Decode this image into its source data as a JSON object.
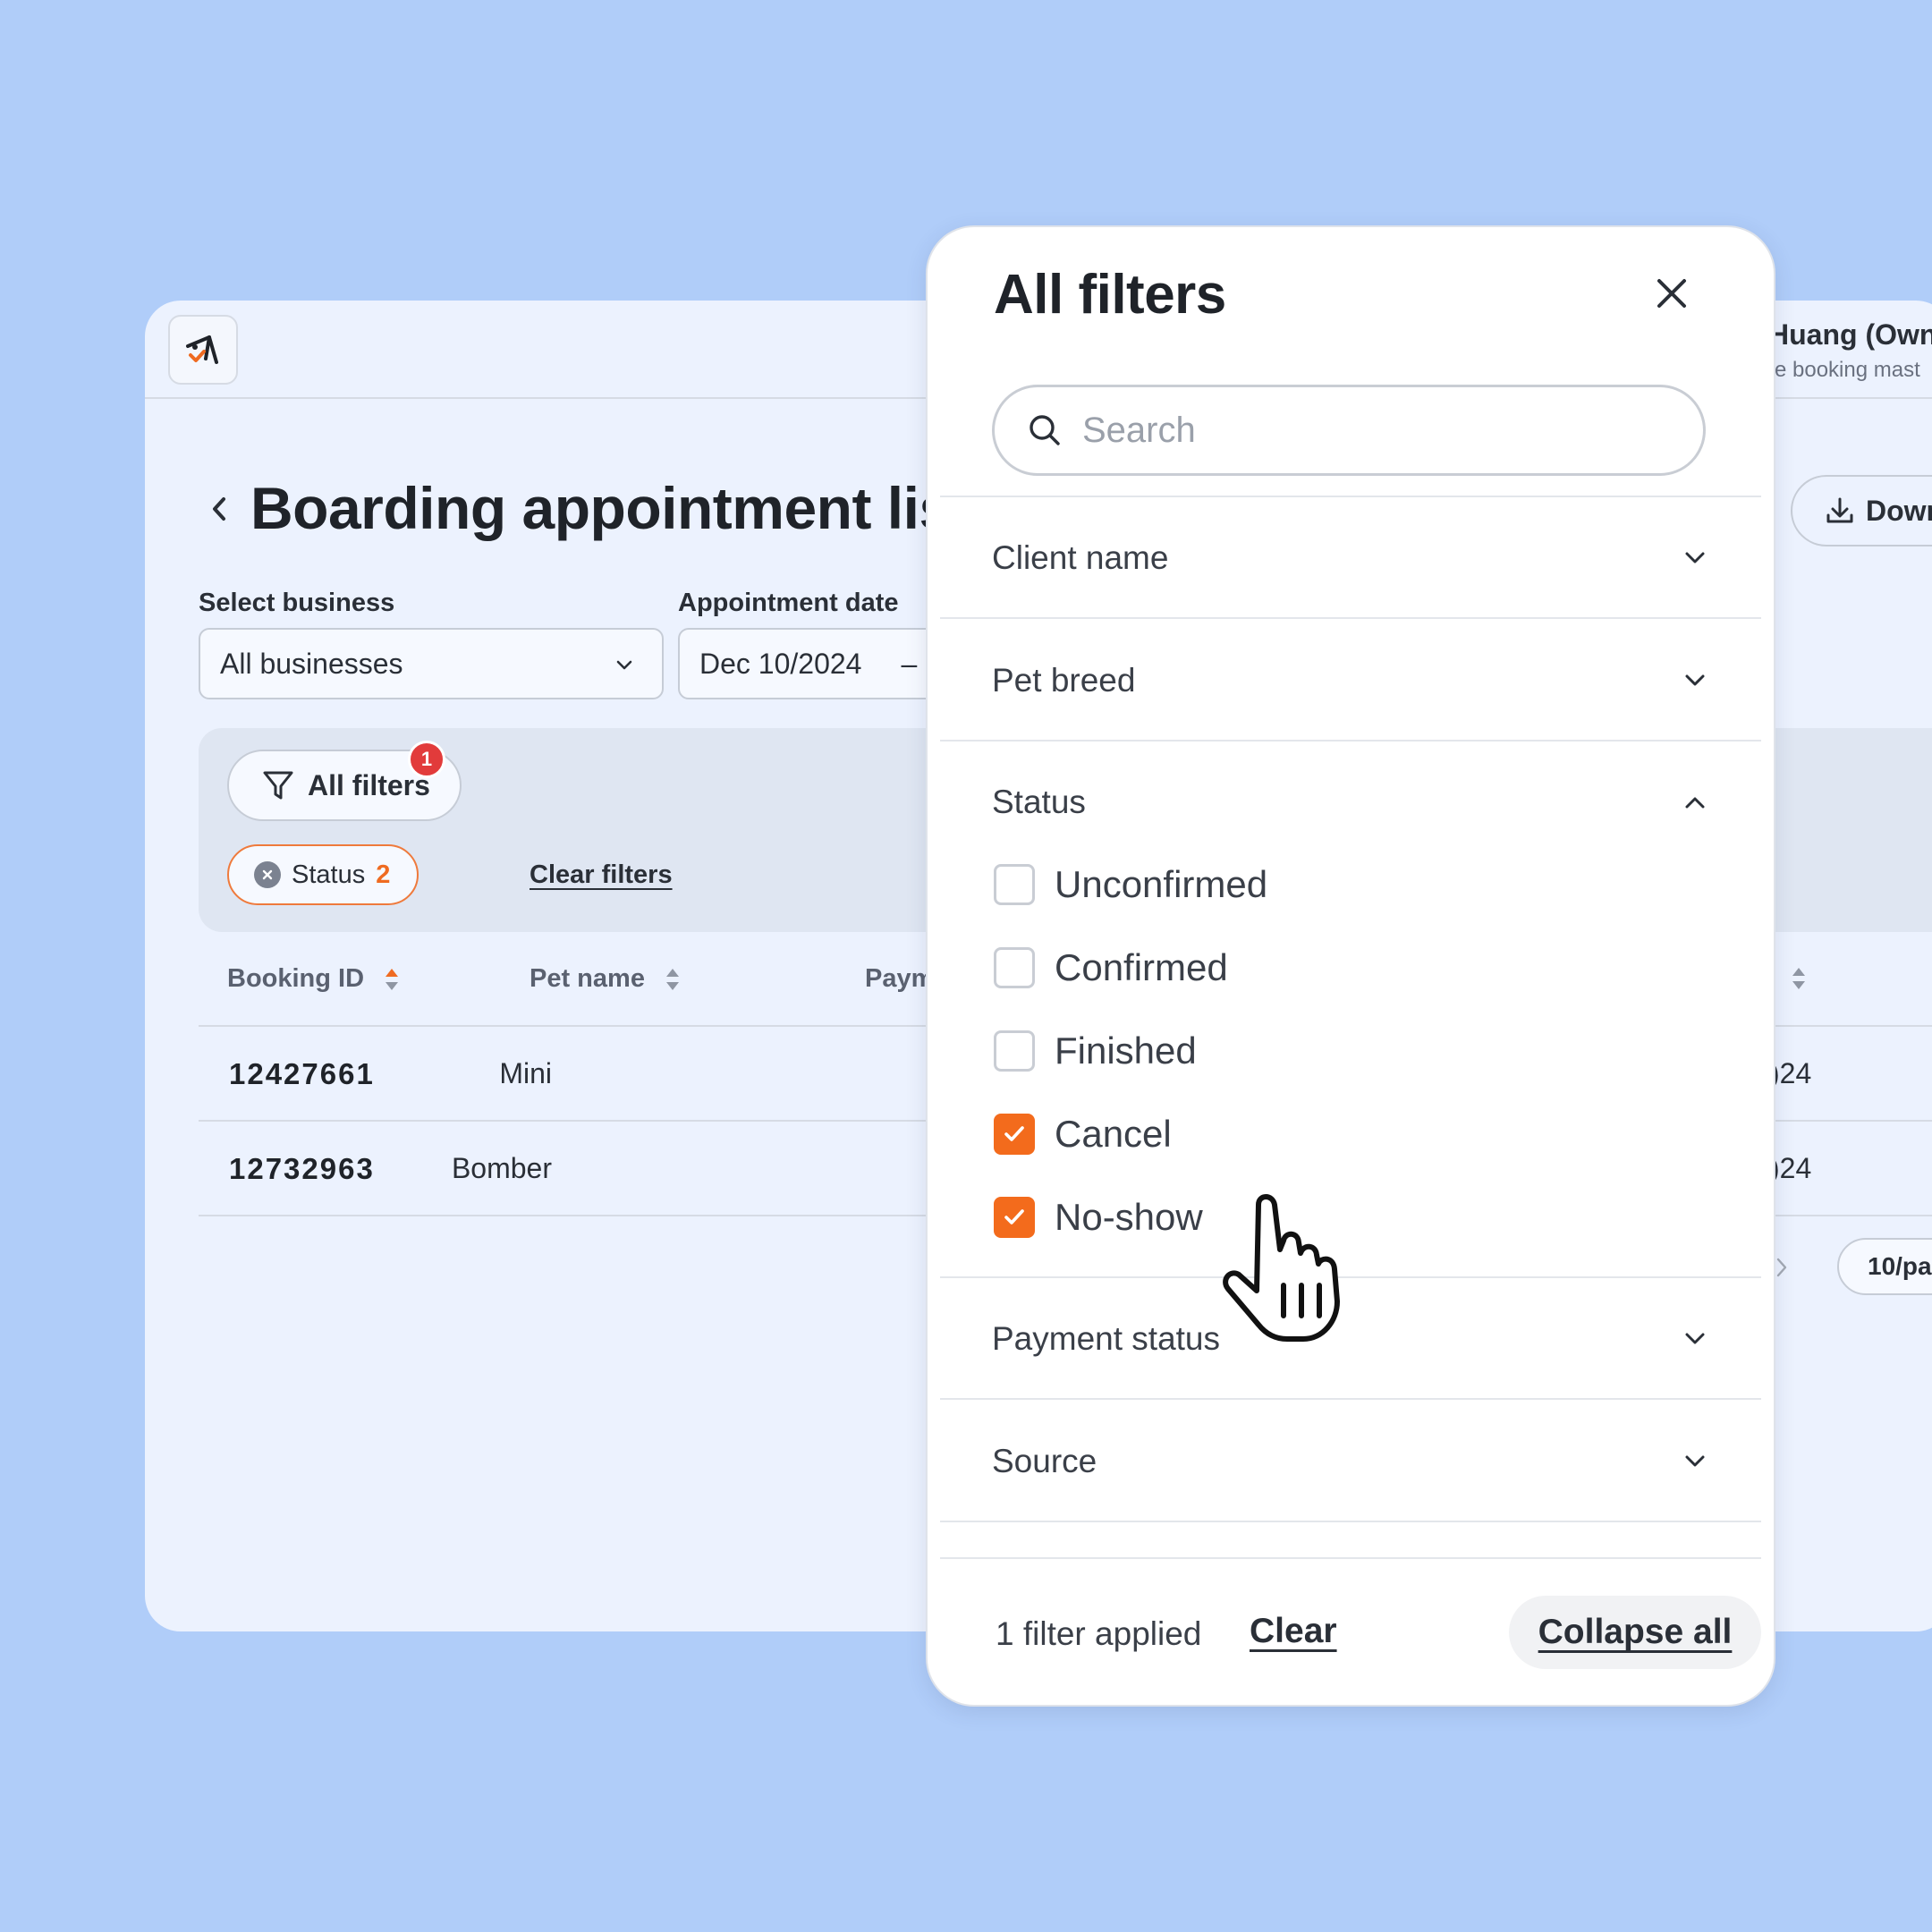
{
  "app": {
    "user_name": "Huang (Own",
    "user_sub": "e booking mast",
    "page_title": "Boarding appointment list",
    "download_label": "Down",
    "select_business_label": "Select business",
    "select_business_value": "All businesses",
    "appointment_date_label": "Appointment date",
    "appointment_date_value": "Dec 10/2024",
    "date_sep": "–",
    "all_filters_label": "All filters",
    "filter_badge": "1",
    "chip_label": "Status",
    "chip_count": "2",
    "clear_filters": "Clear filters",
    "columns": {
      "booking_id": "Booking ID",
      "pet_name": "Pet name",
      "payment": "Paym"
    },
    "rows": [
      {
        "id": "12427661",
        "pet": "Mini",
        "date": ")24"
      },
      {
        "id": "12732963",
        "pet": "Bomber",
        "date": ")24"
      }
    ],
    "page_size": "10/pa"
  },
  "modal": {
    "title": "All filters",
    "search_placeholder": "Search",
    "sections": {
      "client_name": "Client name",
      "pet_breed": "Pet breed",
      "status": "Status",
      "payment_status": "Payment status",
      "source": "Source"
    },
    "status_options": [
      {
        "label": "Unconfirmed",
        "checked": false
      },
      {
        "label": "Confirmed",
        "checked": false
      },
      {
        "label": "Finished",
        "checked": false
      },
      {
        "label": "Cancel",
        "checked": true
      },
      {
        "label": "No-show",
        "checked": true
      }
    ],
    "footer": {
      "applied_text": "1 filter applied",
      "clear_label": "Clear",
      "collapse_label": "Collapse all"
    }
  },
  "colors": {
    "background": "#b0cdf9",
    "app_card": "#ecf2fe",
    "accent_orange": "#f36b1c",
    "badge_red": "#e23b3b"
  },
  "icons": [
    "logo-icon",
    "back-chevron-icon",
    "download-icon",
    "chevron-down-icon",
    "filter-funnel-icon",
    "close-circle-icon",
    "sort-icon",
    "close-icon",
    "search-icon",
    "chevron-up-icon",
    "checkmark-icon",
    "hand-pointer-icon"
  ]
}
